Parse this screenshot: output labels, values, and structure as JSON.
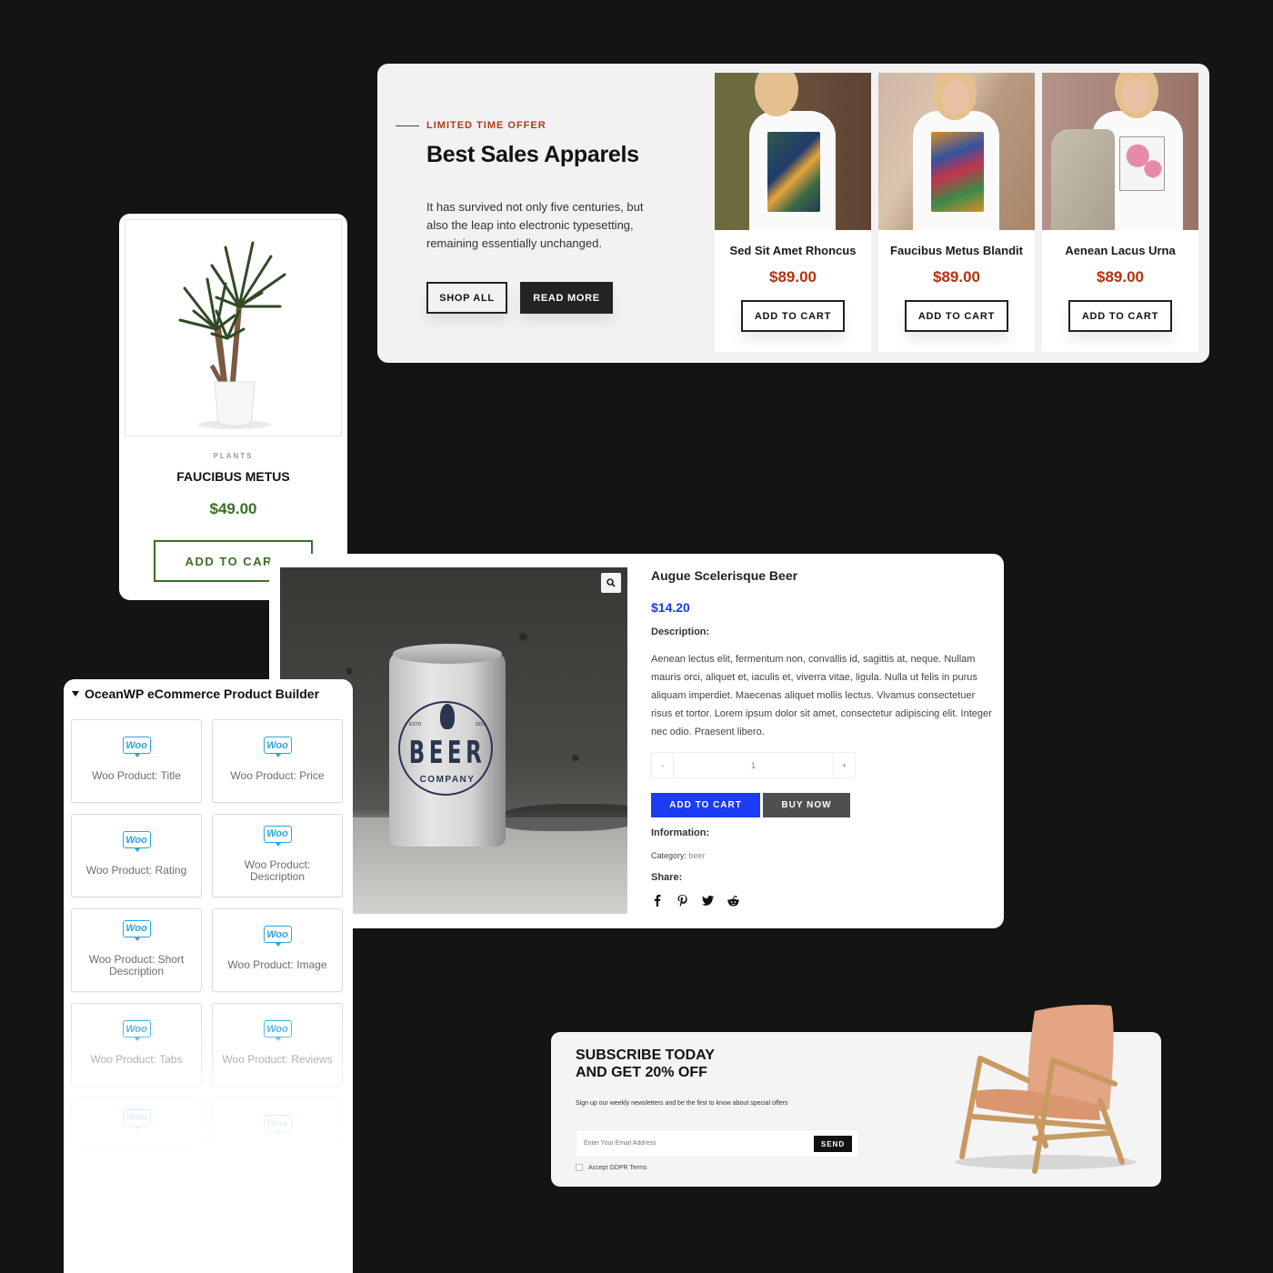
{
  "sales_banner": {
    "eyebrow": "LIMITED TIME OFFER",
    "title": "Best Sales Apparels",
    "body": "It has survived not only five centuries, but also the leap into electronic typesetting, remaining essentially unchanged.",
    "shop_all_label": "SHOP ALL",
    "read_more_label": "READ MORE",
    "accent_color": "#b33a14",
    "products": [
      {
        "name": "Sed Sit Amet Rhoncus",
        "price": "$89.00",
        "button": "ADD TO CART",
        "image": "woman in toucan print t-shirt"
      },
      {
        "name": "Faucibus Metus Blandit",
        "price": "$89.00",
        "button": "ADD TO CART",
        "image": "woman in parrot print t-shirt"
      },
      {
        "name": "Aenean Lacus Urna",
        "price": "$89.00",
        "button": "ADD TO CART",
        "image": "woman in flower print t-shirt with trench coat"
      }
    ]
  },
  "plant_card": {
    "category": "PLANTS",
    "title": "FAUCIBUS METUS",
    "price": "$49.00",
    "button": "ADD TO CART",
    "accent_color": "#3a6f25",
    "image": "potted dracaena plant"
  },
  "beer_product": {
    "name": "Augue Scelerisque Beer",
    "price": "$14.20",
    "price_color": "#1b3bf5",
    "description_label": "Description:",
    "description": "Aenean lectus elit, fermentum non, convallis id, sagittis at, neque. Nullam mauris orci, aliquet et, iaculis et, viverra vitae, ligula. Nulla ut felis in purus aliquam imperdiet. Maecenas aliquet mollis lectus. Vivamus consectetuer risus et tortor. Lorem ipsum dolor sit amet, consectetur adipiscing elit. Integer nec odio. Praesent libero.",
    "quantity": {
      "minus": "-",
      "value": "1",
      "plus": "+"
    },
    "add_to_cart_label": "ADD TO CART",
    "buy_now_label": "BUY NOW",
    "information_label": "Information:",
    "category_label": "Category:",
    "category_value": "beer",
    "share_label": "Share:",
    "share_icons": [
      "facebook-icon",
      "pinterest-icon",
      "twitter-icon",
      "reddit-icon"
    ],
    "can_logo": {
      "brand": "BEER",
      "sub": "COMPANY",
      "estd": "ESTD",
      "year": "2019"
    }
  },
  "builder_panel": {
    "title": "OceanWP eCommerce Product Builder",
    "widget_icon": "Woo",
    "widgets": [
      "Woo Product: Title",
      "Woo Product: Price",
      "Woo Product: Rating",
      "Woo Product: Description",
      "Woo Product: Short Description",
      "Woo Product: Image",
      "Woo Product: Tabs",
      "Woo Product: Reviews",
      "Woo Product: Reviews Slider",
      "Woo Product: Upsell"
    ]
  },
  "subscribe": {
    "title": "SUBSCRIBE TODAY\nAND GET 20% OFF",
    "lead": "Sign up our weekly newsletters and be the first to know about special offers",
    "email_placeholder": "Enter Your Email Address",
    "send_label": "SEND",
    "gdpr_label": "Accept GDPR Terms",
    "image": "wooden lounge chair with tan leather cushion"
  }
}
